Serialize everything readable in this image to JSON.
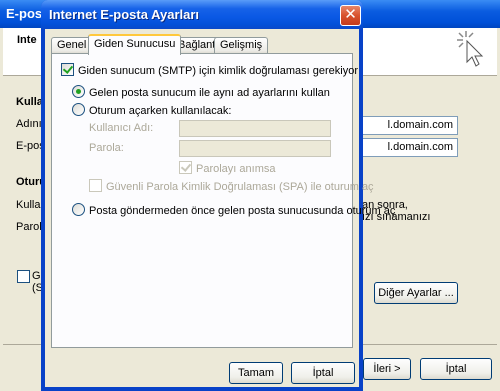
{
  "background": {
    "title": "E-posta",
    "header_title": "Inte",
    "section_user": "Kulla",
    "label_name": "Adınız",
    "label_email": "E-posta",
    "section_login": "Oturu",
    "label_user": "Kullan",
    "label_password": "Parola",
    "domain_value_1": "l.domain.com",
    "domain_value_2": "l.domain.com",
    "text_line_1": "an sonra,",
    "text_line_2": "ızı sınamanızı",
    "checkbox_label_1": "Gü",
    "checkbox_label_2": "(S",
    "more_settings_button": "Diğer Ayarlar ...",
    "next_button": "İleri >",
    "cancel_button": "İptal"
  },
  "dialog": {
    "title": "Internet E-posta Ayarları",
    "tabs": [
      "Genel",
      "Giden Sunucusu",
      "Bağlantı",
      "Gelişmiş"
    ],
    "active_tab": "Giden Sunucusu",
    "smtp_auth_checkbox": "Giden sunucum (SMTP) için kimlik doğrulaması gerekiyor",
    "smtp_auth_checked": true,
    "radio_same_settings": "Gelen posta sunucum ile aynı ad ayarlarını kullan",
    "radio_logon_using": "Oturum açarken kullanılacak:",
    "username_label": "Kullanıcı Adı:",
    "username_value": "",
    "password_label": "Parola:",
    "password_value": "",
    "remember_password": "Parolayı anımsa",
    "spa_checkbox": "Güvenli Parola Kimlik Doğrulaması (SPA) ile oturum aç",
    "radio_logon_before": "Posta göndermeden önce gelen posta sunucusunda oturum aç",
    "selected_radio": "same_settings",
    "ok_button": "Tamam",
    "cancel_button": "İptal"
  }
}
